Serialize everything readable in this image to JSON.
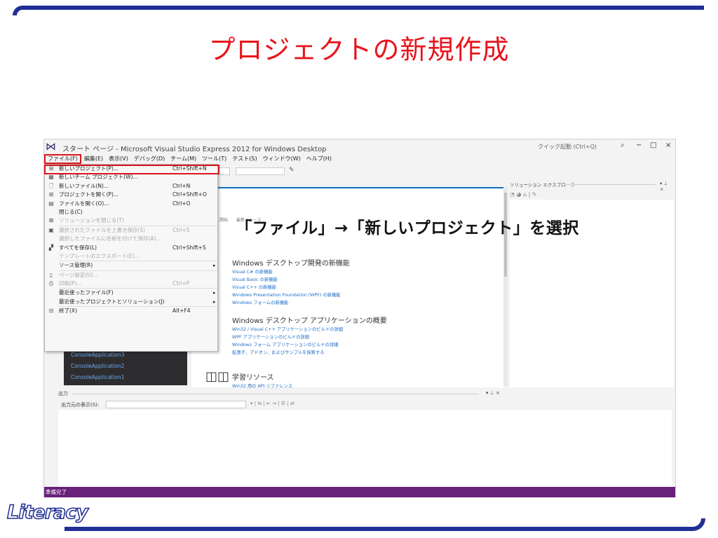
{
  "slide": {
    "title": "プロジェクトの新規作成",
    "callout": "「ファイル」→「新しいプロジェクト」を選択",
    "logo": "Literacy",
    "colors": {
      "title": "#e8141c",
      "frame": "#1f2f96",
      "highlight": "#d8161e",
      "status": "#68217a"
    }
  },
  "ide": {
    "window_title": "スタート ページ - Microsoft Visual Studio Express 2012 for Windows Desktop",
    "quick_launch": "クイック起動 (Ctrl+Q)",
    "window_controls": [
      "−",
      "□",
      "×"
    ],
    "menubar": [
      "ファイル(F)",
      "編集(E)",
      "表示(V)",
      "デバッグ(D)",
      "チーム(M)",
      "ツール(T)",
      "テスト(S)",
      "ウィンドウ(W)",
      "ヘルプ(H)"
    ],
    "file_menu": [
      {
        "icon": "new-project-icon",
        "glyph": "⊞",
        "label": "新しいプロジェクト(P)...",
        "shortcut": "Ctrl+Shift+N",
        "disabled": false,
        "highlight": true
      },
      {
        "icon": "team-project-icon",
        "glyph": "▦",
        "label": "新しいチーム プロジェクト(W)...",
        "shortcut": "",
        "disabled": false
      },
      {
        "icon": "new-file-icon",
        "glyph": "🗋",
        "label": "新しいファイル(N)...",
        "shortcut": "Ctrl+N",
        "disabled": false
      },
      {
        "icon": "open-project-icon",
        "glyph": "⊞",
        "label": "プロジェクトを開く(P)...",
        "shortcut": "Ctrl+Shift+O",
        "disabled": false
      },
      {
        "icon": "open-file-icon",
        "glyph": "▤",
        "label": "ファイルを開く(O)...",
        "shortcut": "Ctrl+O",
        "disabled": false
      },
      {
        "icon": "",
        "glyph": "",
        "label": "閉じる(C)",
        "shortcut": "",
        "disabled": false
      },
      {
        "icon": "close-solution-icon",
        "glyph": "⊠",
        "label": "ソリューションを閉じる(T)",
        "shortcut": "",
        "disabled": true,
        "sep_after": true
      },
      {
        "icon": "save-icon",
        "glyph": "▣",
        "label": "選択されたファイルを上書き保存(S)",
        "shortcut": "Ctrl+S",
        "disabled": true
      },
      {
        "icon": "",
        "glyph": "",
        "label": "選択したファイルに名前を付けて保存(A)...",
        "shortcut": "",
        "disabled": true
      },
      {
        "icon": "save-all-icon",
        "glyph": "▞",
        "label": "すべてを保存(L)",
        "shortcut": "Ctrl+Shift+S",
        "disabled": false
      },
      {
        "icon": "",
        "glyph": "",
        "label": "テンプレートのエクスポート(E)...",
        "shortcut": "",
        "disabled": true,
        "sep_after": true
      },
      {
        "icon": "",
        "glyph": "",
        "label": "ソース管理(R)",
        "shortcut": "",
        "disabled": false,
        "arrow": "▸",
        "sep_after": true
      },
      {
        "icon": "page-setup-icon",
        "glyph": "▯",
        "label": "ページ設定(U)...",
        "shortcut": "",
        "disabled": true
      },
      {
        "icon": "print-icon",
        "glyph": "⎙",
        "label": "印刷(P)...",
        "shortcut": "Ctrl+P",
        "disabled": true,
        "sep_after": true
      },
      {
        "icon": "",
        "glyph": "",
        "label": "最近使ったファイル(F)",
        "shortcut": "",
        "disabled": false,
        "arrow": "▸"
      },
      {
        "icon": "",
        "glyph": "",
        "label": "最近使ったプロジェクトとソリューション(J)",
        "shortcut": "",
        "disabled": false,
        "arrow": "▸",
        "sep_after": true
      },
      {
        "icon": "exit-icon",
        "glyph": "⊟",
        "label": "終了(X)",
        "shortcut": "Alt+F4",
        "disabled": false
      }
    ],
    "recent_projects": [
      "ConsoleApplication3",
      "ConsoleApplication2",
      "ConsoleApplication1"
    ],
    "start_page": {
      "tabs": [
        "開始",
        "最新ニュース"
      ],
      "sections": [
        {
          "title": "Windows デスクトップ開発の新機能",
          "links": [
            "Visual C# の新機能",
            "Visual Basic の新機能",
            "Visual C++ の新機能",
            "Windows Presentation Foundation (WPF) の新機能",
            "Windows フォームの新機能"
          ]
        },
        {
          "title": "Windows デスクトップ アプリケーションの概要",
          "links": [
            "Win32 / Visual C++ アプリケーションのビルドの詳細",
            "WPF アプリケーションのビルドの詳細",
            "Windows フォーム アプリケーションのビルドの詳細",
            "拡張子、アドオン、およびサンプルを探索する"
          ]
        },
        {
          "title": "学習リソース",
          "links": [
            "Win32 用の API リファレンス"
          ]
        }
      ]
    },
    "solution_explorer": {
      "title": "ソリューション エクスプローラー",
      "pin": "▾ ⊥ ×"
    },
    "output": {
      "title": "出力",
      "source_label": "出力元の表示(S):",
      "pin": "▾ ⊥ ×"
    },
    "status": "準備完了"
  }
}
